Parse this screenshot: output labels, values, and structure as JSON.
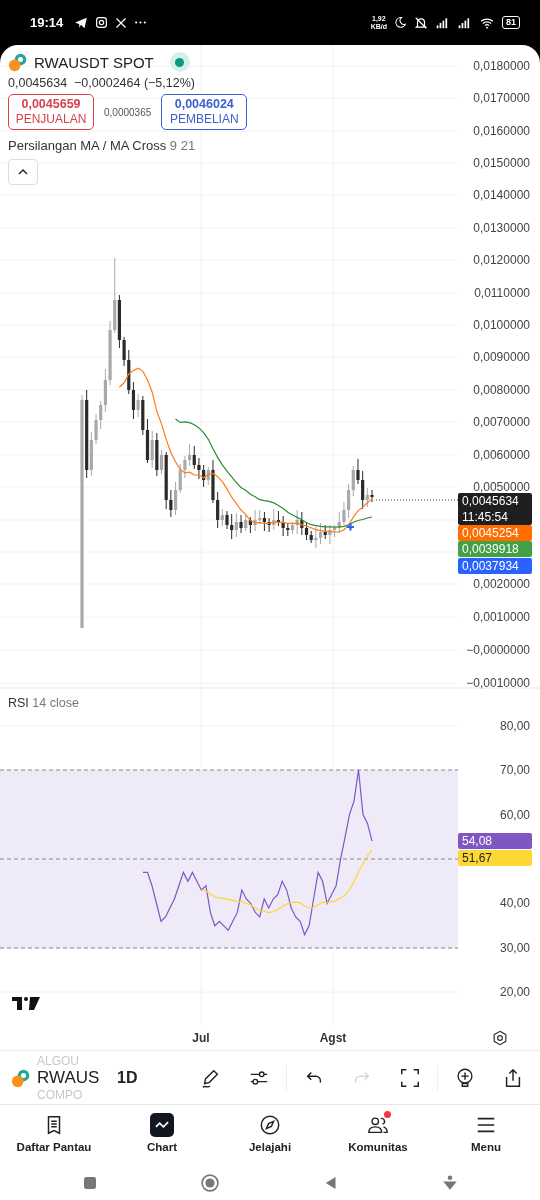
{
  "status_bar": {
    "time": "19:14",
    "net_speed": "1,92",
    "net_unit": "KB/d",
    "battery": "81"
  },
  "symbol": {
    "name": "RWAUSDT SPOT"
  },
  "quote": {
    "price": "0,0045634",
    "change": "−0,0002464 (−5,12%)"
  },
  "sell": {
    "price": "0,0045659",
    "label": "PENJUALAN"
  },
  "spread": "0,0000365",
  "buy": {
    "price": "0,0046024",
    "label": "PEMBELIAN"
  },
  "indicator": {
    "name": "Persilangan MA / MA Cross",
    "params": "9 21"
  },
  "price_axis": [
    "0,0180000",
    "0,0170000",
    "0,0160000",
    "0,0150000",
    "0,0140000",
    "0,0130000",
    "0,0120000",
    "0,0110000",
    "0,0100000",
    "0,0090000",
    "0,0080000",
    "0,0070000",
    "0,0060000",
    "0,0050000",
    "0,0020000",
    "0,0010000",
    "−0,0000000",
    "−0,0010000"
  ],
  "price_tags": [
    {
      "value": "0,0045634",
      "time": "11:45:54",
      "color": "#1f1f1f"
    },
    {
      "value": "0,0045254",
      "color": "#ff6d00"
    },
    {
      "value": "0,0039918",
      "color": "#43a047"
    },
    {
      "value": "0,0037934",
      "color": "#2962ff"
    }
  ],
  "rsi": {
    "name": "RSI",
    "params": "14 close",
    "axis": [
      "80,00",
      "70,00",
      "60,00",
      "40,00",
      "30,00",
      "20,00"
    ],
    "tags": [
      {
        "value": "54,08",
        "color": "#7e57c2"
      },
      {
        "value": "51,67",
        "color": "#fdd835"
      }
    ]
  },
  "time_axis": [
    "Jul",
    "Agst"
  ],
  "toolbar": {
    "symbol_above": "ALGOU",
    "symbol": "RWAUS",
    "symbol_below": "COMPO",
    "interval": "1D",
    "redo_disabled": true
  },
  "nav": [
    {
      "label": "Daftar Pantau",
      "kind": "watchlist",
      "selected": false,
      "badge": false
    },
    {
      "label": "Chart",
      "kind": "chart",
      "selected": true,
      "badge": false
    },
    {
      "label": "Jelajahi",
      "kind": "explore",
      "selected": false,
      "badge": false
    },
    {
      "label": "Komunitas",
      "kind": "community",
      "selected": false,
      "badge": true
    },
    {
      "label": "Menu",
      "kind": "menu",
      "selected": false,
      "badge": false
    }
  ]
}
